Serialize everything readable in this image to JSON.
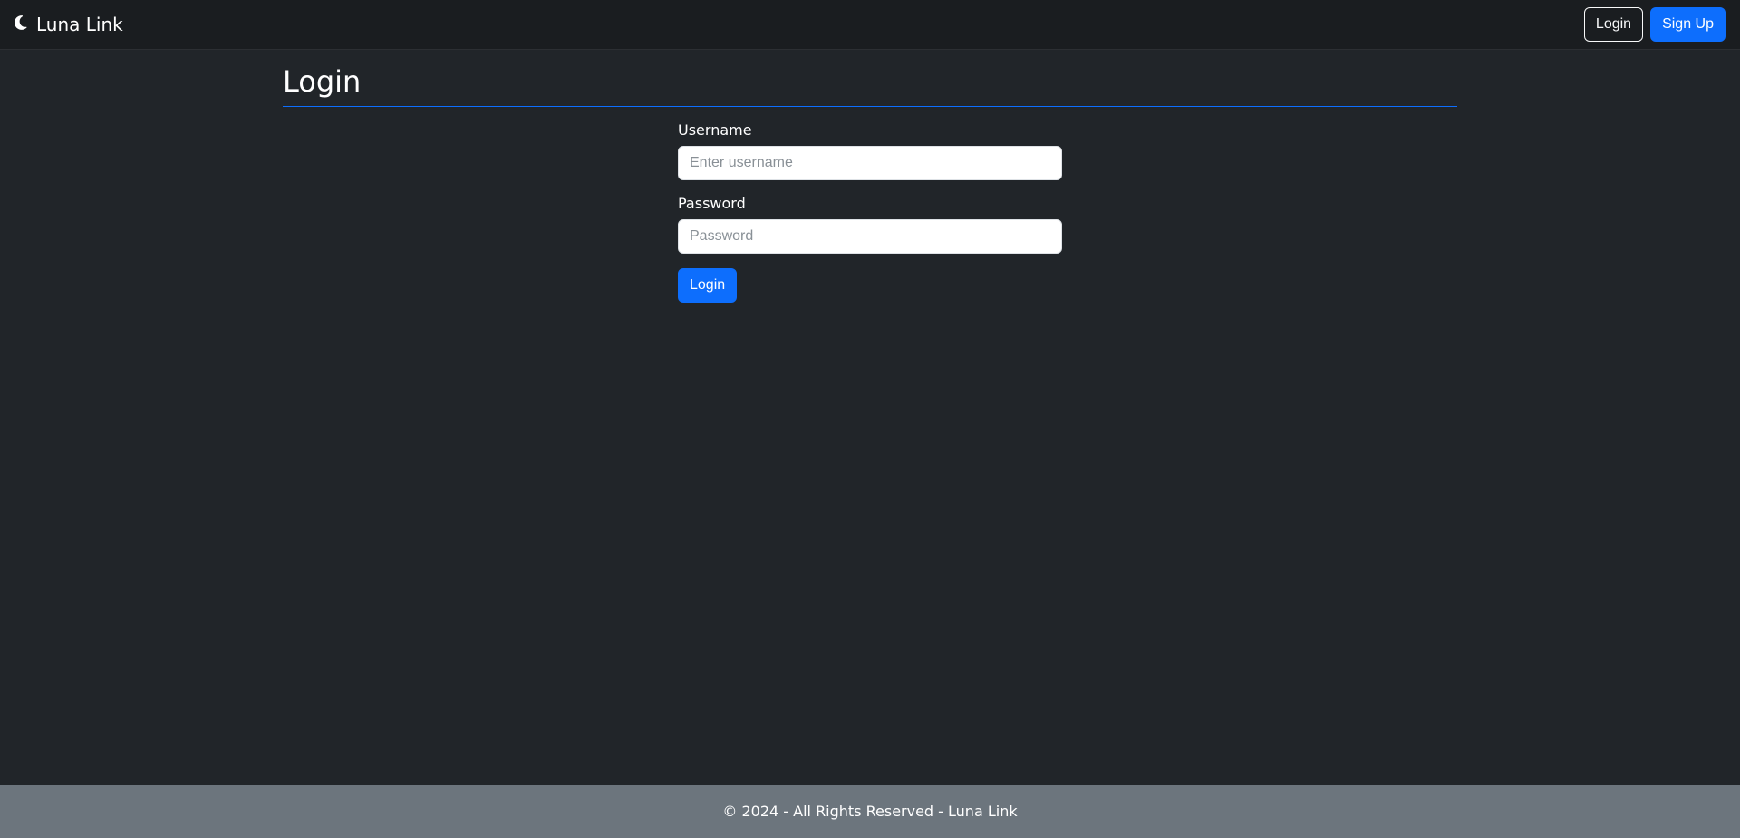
{
  "navbar": {
    "brand": "Luna Link",
    "login_label": "Login",
    "signup_label": "Sign Up"
  },
  "page": {
    "title": "Login"
  },
  "form": {
    "username_label": "Username",
    "username_placeholder": "Enter username",
    "username_value": "",
    "password_label": "Password",
    "password_placeholder": "Password",
    "password_value": "",
    "submit_label": "Login"
  },
  "footer": {
    "text": "© 2024 - All Rights Reserved - Luna Link"
  }
}
